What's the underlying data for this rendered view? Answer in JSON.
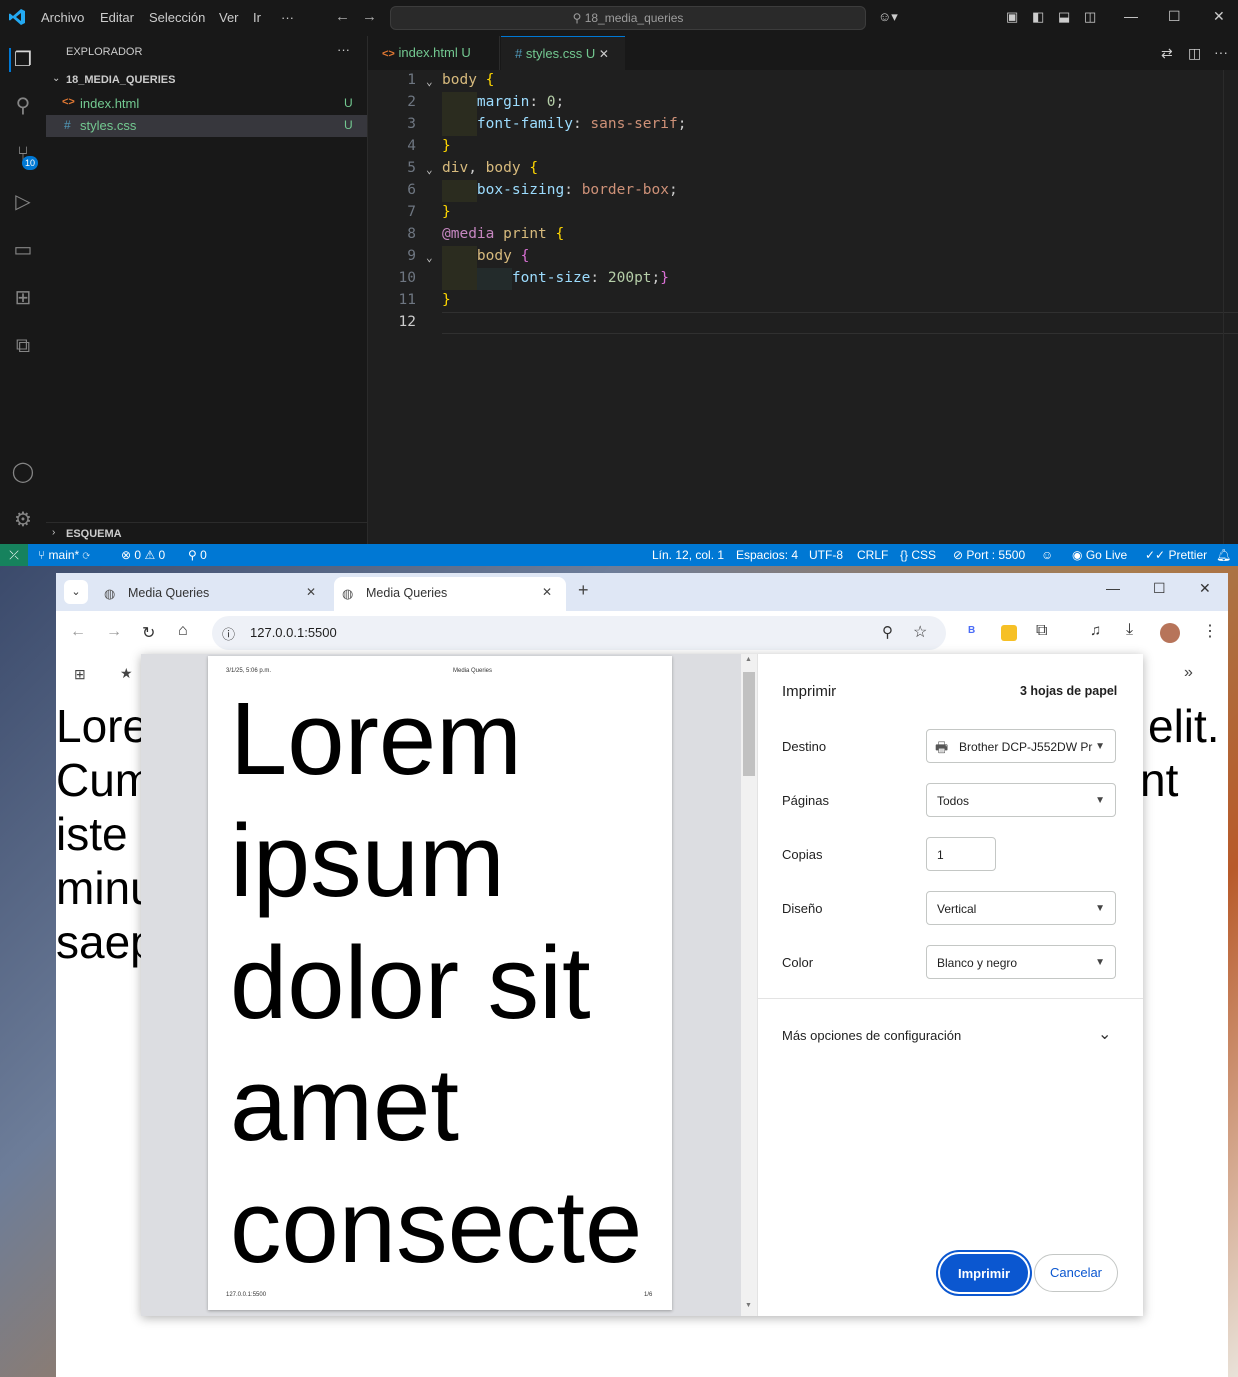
{
  "vscode": {
    "menu": [
      "Archivo",
      "Editar",
      "Selección",
      "Ver",
      "Ir",
      "···"
    ],
    "command_center": "18_media_queries",
    "sidebar": {
      "title": "EXPLORADOR",
      "more": "···",
      "folder": "18_MEDIA_QUERIES",
      "files": [
        {
          "name": "index.html",
          "status": "U",
          "icon": "<>"
        },
        {
          "name": "styles.css",
          "status": "U",
          "icon": "#"
        }
      ],
      "outline": "ESQUEMA"
    },
    "source_control_badge": "10",
    "tabs": [
      {
        "label": "index.html",
        "status": "U",
        "icon": "<>"
      },
      {
        "label": "styles.css",
        "status": "U",
        "icon": "#",
        "close": "✕"
      }
    ],
    "line_numbers": [
      "1",
      "2",
      "3",
      "4",
      "5",
      "6",
      "7",
      "8",
      "9",
      "10",
      "11",
      "12"
    ],
    "status": {
      "branch": "main*",
      "errors": "0",
      "warnings": "0",
      "ports": "0",
      "position": "Lín. 12, col. 1",
      "spaces": "Espacios: 4",
      "encoding": "UTF-8",
      "eol": "CRLF",
      "language": "CSS",
      "port": "Port : 5500",
      "golive": "Go Live",
      "prettier": "Prettier"
    },
    "colors": {
      "accent": "#0078d4",
      "bg": "#1f1f1f",
      "sidebar": "#181818"
    }
  },
  "chrome": {
    "tabs": [
      {
        "title": "Media Queries"
      },
      {
        "title": "Media Queries"
      }
    ],
    "new_tab": "+",
    "url": "127.0.0.1:5500",
    "page_text_left": [
      "Lore",
      "Cum",
      "iste",
      "minu",
      "saep"
    ],
    "page_text_right": [
      "elit.",
      "nt"
    ]
  },
  "print": {
    "title": "Imprimir",
    "sheets": "3 hojas de papel",
    "destination_label": "Destino",
    "destination_value": "Brother DCP-J552DW Pr",
    "pages_label": "Páginas",
    "pages_value": "Todos",
    "copies_label": "Copias",
    "copies_value": "1",
    "layout_label": "Diseño",
    "layout_value": "Vertical",
    "color_label": "Color",
    "color_value": "Blanco y negro",
    "more_settings": "Más opciones de configuración",
    "print_button": "Imprimir",
    "cancel_button": "Cancelar",
    "preview": {
      "date": "3/1/25, 5:06 p.m.",
      "header_title": "Media Queries",
      "words": [
        "Lorem",
        "ipsum",
        "dolor sit",
        "amet",
        "consecte"
      ],
      "footer_url": "127.0.0.1:5500",
      "footer_page": "1/6"
    }
  }
}
